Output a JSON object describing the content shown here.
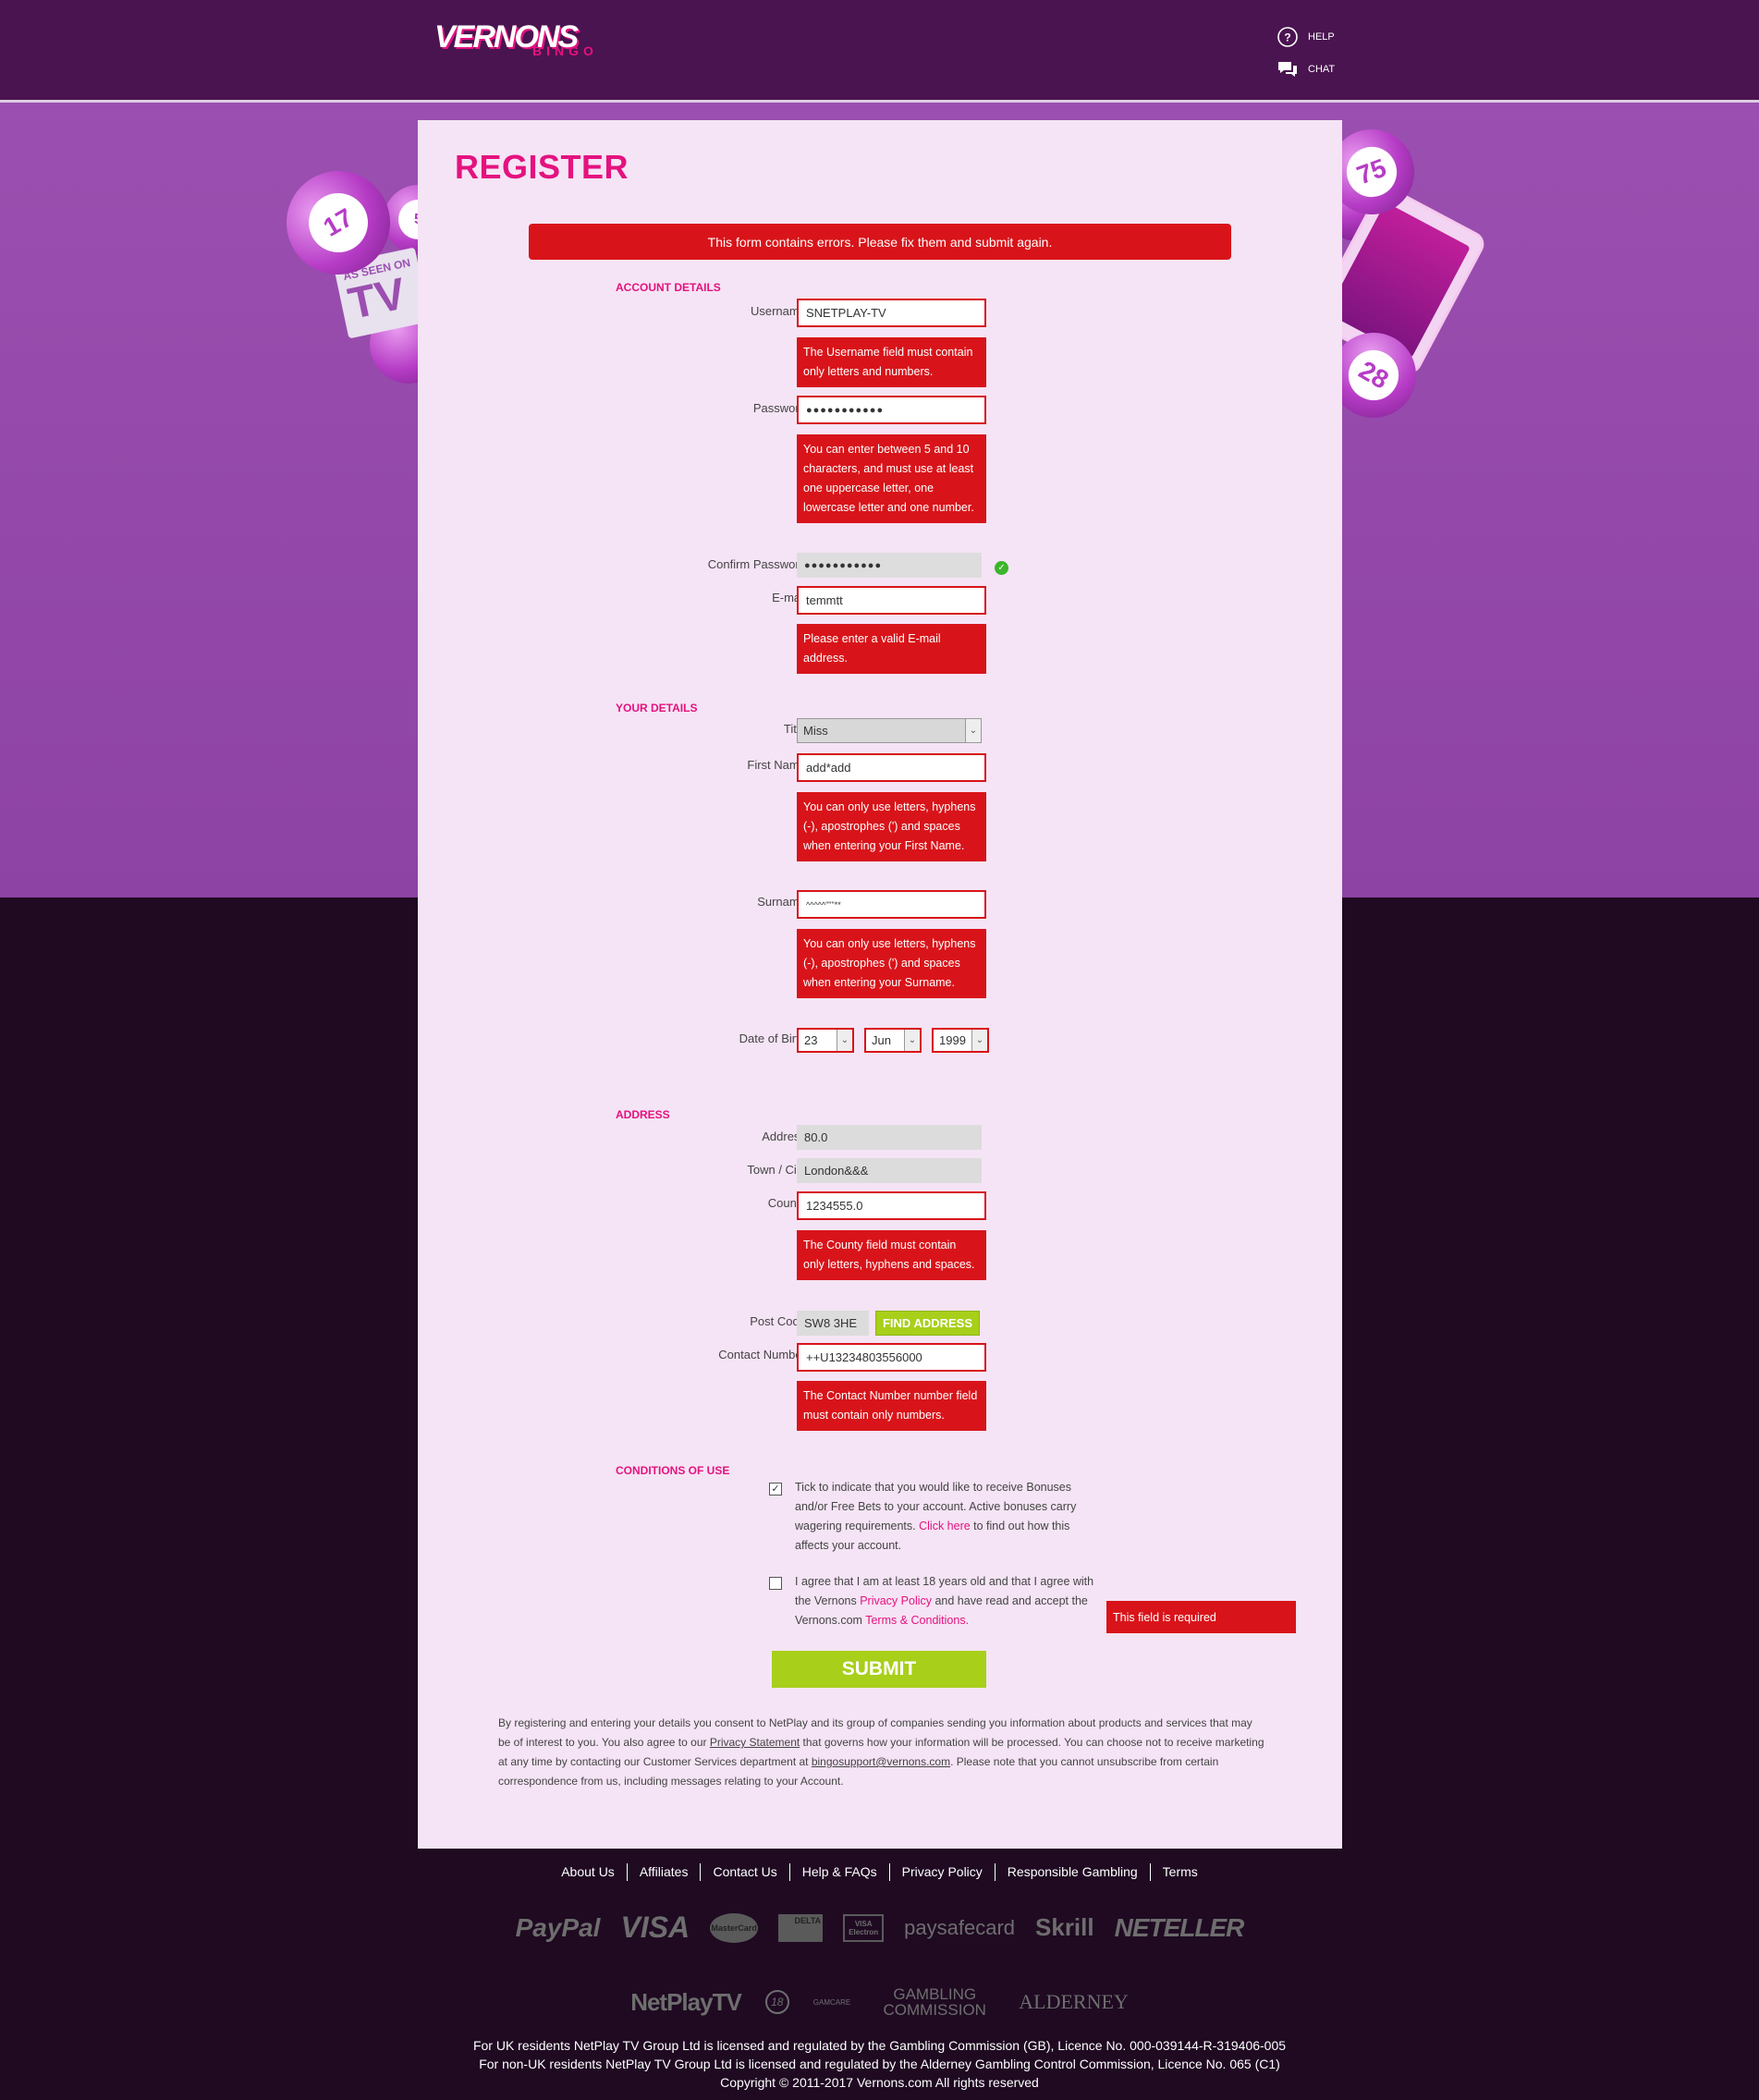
{
  "header": {
    "logo_main": "VERNONS",
    "logo_sub": "BINGO",
    "help_label": "HELP",
    "chat_label": "CHAT"
  },
  "decor": {
    "ball_17": "17",
    "ball_5": "5",
    "ball_75": "75",
    "ball_28": "28",
    "tv_line1": "AS SEEN ON",
    "tv_line2": "TV"
  },
  "form": {
    "title": "REGISTER",
    "error_banner": "This form contains errors. Please fix them and submit again.",
    "required_mark": "*",
    "sections": {
      "account": "ACCOUNT DETAILS",
      "your_details": "YOUR DETAILS",
      "address": "ADDRESS",
      "conditions": "CONDITIONS OF USE"
    },
    "username": {
      "label": "Username",
      "value": "SNETPLAY-TV",
      "error": "The Username field must contain only letters and numbers."
    },
    "password": {
      "label": "Password",
      "value": "●●●●●●●●●●●",
      "error": "You can enter between 5 and 10 characters, and must use at least one uppercase letter, one lowercase letter and one number."
    },
    "confirm_password": {
      "label": "Confirm Password",
      "value": "●●●●●●●●●●●"
    },
    "email": {
      "label": "E-mail",
      "value": "temmtt",
      "error": "Please enter a valid E-mail address."
    },
    "title_field": {
      "label": "Title",
      "value": "Miss"
    },
    "first_name": {
      "label": "First Name",
      "value": "add*add",
      "error": "You can only use letters, hyphens (-), apostrophes (') and spaces when entering your First Name."
    },
    "surname": {
      "label": "Surname",
      "value": "^^^^^\"\"\"**",
      "error": "You can only use letters, hyphens (-), apostrophes (') and spaces when entering your Surname."
    },
    "dob": {
      "label": "Date of Birth",
      "day": "23",
      "month": "Jun",
      "year": "1999"
    },
    "address": {
      "label": "Address",
      "value": "80.0"
    },
    "town": {
      "label": "Town / City",
      "value": "London&&&"
    },
    "county": {
      "label": "County",
      "value": "1234555.0",
      "error": "The County field must contain only letters, hyphens and spaces."
    },
    "postcode": {
      "label": "Post Code",
      "value": "SW8 3HE",
      "find_button": "FIND ADDRESS"
    },
    "contact": {
      "label": "Contact Number",
      "value": "++U13234803556000",
      "error": "The Contact Number number field must contain only numbers."
    },
    "bonus_checkbox": {
      "checked_mark": "✓",
      "text_before": "Tick to indicate that you would like to receive Bonuses and/or Free Bets to your account. Active bonuses carry wagering requirements. ",
      "link": "Click here",
      "text_after": " to find out how this affects your account."
    },
    "age_checkbox": {
      "text_before": "I agree that I am at least 18 years old and that I agree with the Vernons ",
      "link1": "Privacy Policy",
      "text_mid": " and have read and accept the Vernons.com ",
      "link2": "Terms & Conditions",
      "text_after": ".",
      "error": "This field is required"
    },
    "submit": "SUBMIT",
    "consent": {
      "part1": "By registering and entering your details you consent to NetPlay and its group of companies sending you information about products and services that may be of interest to you. You also agree to our ",
      "privacy_link": "Privacy Statement",
      "part2": " that governs how your information will be processed. You can choose not to receive marketing at any time by contacting our Customer Services department at ",
      "email_link": "bingosupport@vernons.com",
      "part3": ". Please note that you cannot unsubscribe from certain correspondence from us, including messages relating to your Account."
    }
  },
  "footer": {
    "links": [
      "About Us",
      "Affiliates",
      "Contact Us",
      "Help & FAQs",
      "Privacy Policy",
      "Responsible Gambling",
      "Terms"
    ],
    "payments": [
      "PayPal",
      "VISA",
      "MasterCard",
      "DELTA",
      "VISA Electron",
      "paysafecard",
      "Skrill",
      "NETELLER"
    ],
    "regulators": [
      "NetPlayTV",
      "18",
      "GAMCARE",
      "GAMBLING COMMISSION",
      "ALDERNEY"
    ],
    "legal1": "For UK residents NetPlay TV Group Ltd is licensed and regulated by the Gambling Commission (GB), Licence No. 000-039144-R-319406-005",
    "legal2": "For non-UK residents NetPlay TV Group Ltd is licensed and regulated by the Alderney Gambling Control Commission, Licence No. 065 (C1)",
    "legal3": "Copyright © 2011-2017 Vernons.com All rights reserved"
  }
}
